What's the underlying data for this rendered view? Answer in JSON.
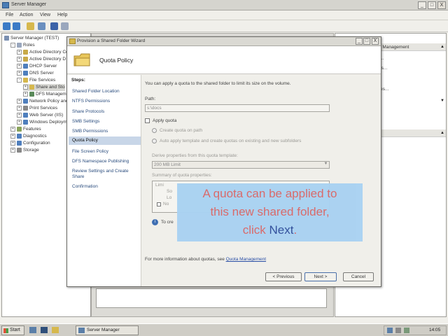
{
  "window": {
    "title": "Server Manager",
    "min": "_",
    "max": "□",
    "close": "X"
  },
  "menu": [
    "File",
    "Action",
    "View",
    "Help"
  ],
  "tree": [
    {
      "label": "Server Manager (TEST)",
      "level": 0,
      "exp": "",
      "color": "#7a8fb0"
    },
    {
      "label": "Roles",
      "level": 1,
      "exp": "-",
      "color": "#9aa7bd"
    },
    {
      "label": "Active Directory Ce",
      "level": 2,
      "exp": "+",
      "color": "#c8a949"
    },
    {
      "label": "Active Directory D",
      "level": 2,
      "exp": "+",
      "color": "#c8a949"
    },
    {
      "label": "DHCP Server",
      "level": 2,
      "exp": "+",
      "color": "#4f7fbd"
    },
    {
      "label": "DNS Server",
      "level": 2,
      "exp": "+",
      "color": "#4f7fbd"
    },
    {
      "label": "File Services",
      "level": 2,
      "exp": "-",
      "color": "#d6b84d"
    },
    {
      "label": "Share and Sto",
      "level": 3,
      "exp": "+",
      "color": "#d6b84d"
    },
    {
      "label": "DFS Managem",
      "level": 3,
      "exp": "+",
      "color": "#5a8a5a"
    },
    {
      "label": "Network Policy and",
      "level": 2,
      "exp": "+",
      "color": "#4f7fbd"
    },
    {
      "label": "Print Services",
      "level": 2,
      "exp": "+",
      "color": "#888"
    },
    {
      "label": "Web Server (IIS)",
      "level": 2,
      "exp": "+",
      "color": "#4f7fbd"
    },
    {
      "label": "Windows Deploym",
      "level": 2,
      "exp": "+",
      "color": "#4f7fbd"
    },
    {
      "label": "Features",
      "level": 1,
      "exp": "+",
      "color": "#8aa35a"
    },
    {
      "label": "Diagnostics",
      "level": 1,
      "exp": "+",
      "color": "#4f7fbd"
    },
    {
      "label": "Configuration",
      "level": 1,
      "exp": "+",
      "color": "#4f7fbd"
    },
    {
      "label": "Storage",
      "level": 1,
      "exp": "+",
      "color": "#888"
    }
  ],
  "actions": {
    "header": "e Management",
    "items": [
      "r...",
      "ns...",
      "",
      "res...",
      ""
    ]
  },
  "wizard": {
    "title": "Provision a Shared Folder Wizard",
    "page_title": "Quota Policy",
    "steps_header": "Steps:",
    "steps": [
      "Shared Folder Location",
      "NTFS Permissions",
      "Share Protocols",
      "SMB Settings",
      "SMB Permissions",
      "Quota Policy",
      "File Screen Policy",
      "DFS Namespace Publishing",
      "Review Settings and Create Share",
      "Confirmation"
    ],
    "intro": "You can apply a quota to the shared folder to limit its size on the volume.",
    "path_label": "Path:",
    "path_value": "s:\\docs",
    "apply_quota": "Apply quota",
    "radio1": "Create quota on path",
    "radio2": "Auto apply template and create quotas on existing and new subfolders",
    "template_label": "Derive properties from this quota template:",
    "template_value": "200 MB Limit",
    "summary_label": "Summary of quota properties:",
    "summary_items": [
      "Limi",
      "So",
      "Lo",
      "No"
    ],
    "info_text": "To cre",
    "footer_text": "For more information about quotas, see",
    "footer_link": "Quota Management",
    "btn_prev": "< Previous",
    "btn_next": "Next >",
    "btn_cancel": "Cancel"
  },
  "callout": {
    "line1": "A quota can be applied to",
    "line2": "this new shared folder,",
    "line3a": "click ",
    "line3b": "Next",
    "line3c": "."
  },
  "taskbar": {
    "start": "Start",
    "task": "Server Manager",
    "clock": "14:05"
  }
}
